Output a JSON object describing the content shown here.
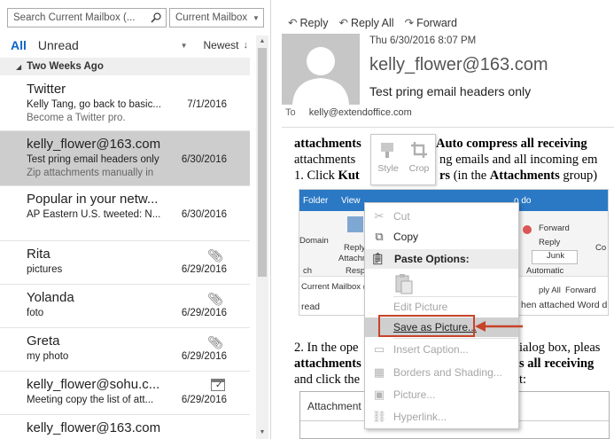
{
  "search": {
    "placeholder": "Search Current Mailbox (...",
    "scope": "Current Mailbox"
  },
  "filters": {
    "all": "All",
    "unread": "Unread",
    "sort": "Newest"
  },
  "group": {
    "label": "Two Weeks Ago"
  },
  "messages": [
    {
      "from": "Twitter",
      "subject": "Kelly Tang, go back to basic...",
      "date": "7/1/2016",
      "preview": "Become a Twitter pro."
    },
    {
      "from": "kelly_flower@163.com",
      "subject": "Test pring email headers only",
      "date": "6/30/2016",
      "preview": "Zip attachments manually in"
    },
    {
      "from": "Popular in your netw...",
      "subject": "AP Eastern U.S. tweeted: N...",
      "date": "6/30/2016",
      "preview": ""
    },
    {
      "from": "Rita",
      "subject": "pictures",
      "date": "6/29/2016",
      "preview": ""
    },
    {
      "from": "Yolanda",
      "subject": "foto",
      "date": "6/29/2016",
      "preview": ""
    },
    {
      "from": "Greta",
      "subject": "my photo",
      "date": "6/29/2016",
      "preview": ""
    },
    {
      "from": "kelly_flower@sohu.c...",
      "subject": "Meeting copy the list of att...",
      "date": "6/29/2016",
      "preview": ""
    },
    {
      "from": "kelly_flower@163.com",
      "subject": "",
      "date": "",
      "preview": ""
    }
  ],
  "reading": {
    "actions": {
      "reply": "Reply",
      "reply_all": "Reply All",
      "forward": "Forward"
    },
    "date": "Thu 6/30/2016 8:07 PM",
    "sender": "kelly_flower@163.com",
    "subject": "Test pring email headers only",
    "to_label": "To",
    "to": "kelly@extendoffice.com"
  },
  "body": {
    "l1a": "attachments",
    "l1b": "Auto compress all receiving",
    "l2a": "attachments",
    "l2b": "ng emails and all incoming em",
    "l3a": "1. Click ",
    "l3b": "Kut",
    "l3c": "rs",
    "l3d": " (in the ",
    "l3e": "Attachments",
    "l3f": " group)",
    "l4a": "2. In the ope",
    "l4b": "ialog box, pleas",
    "l5a": "attachments",
    "l5b": "s all receiving",
    "l6a": "and click the",
    "l6b": "t:"
  },
  "shot1": {
    "tab_folder": "Folder",
    "tab_view": "View",
    "tab_to": "o do",
    "domain": "Domain",
    "reply": "Reply",
    "attach": "Attachm",
    "resp": "Resp",
    "ch": "ch",
    "forward": "Forward",
    "reply2": "Reply",
    "junk": "Junk",
    "automatic": "Automatic",
    "co": "Co",
    "mailbox": "Current Mailbox (",
    "ply_all": "ply All",
    "forward2": "Forward",
    "read": "read",
    "hen": "hen attached Word d"
  },
  "shot2": {
    "title": "Attachment"
  },
  "minitoolbar": {
    "style": "Style",
    "crop": "Crop"
  },
  "context_menu": {
    "cut": "Cut",
    "copy": "Copy",
    "paste_options": "Paste Options:",
    "edit_picture": "Edit Picture",
    "save_as_picture": "Save as Picture...",
    "insert_caption": "Insert Caption...",
    "borders_shading": "Borders and Shading...",
    "picture": "Picture...",
    "hyperlink": "Hyperlink..."
  },
  "colors": {
    "accent": "#0a64c8",
    "highlight_box": "#c7432a",
    "ribbon": "#2b79c5"
  }
}
